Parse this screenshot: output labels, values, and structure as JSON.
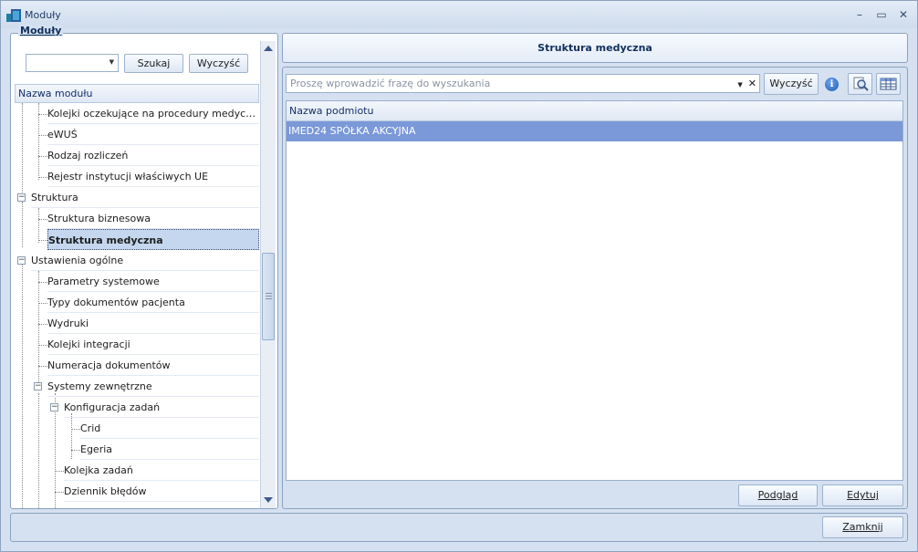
{
  "window": {
    "title": "Moduły"
  },
  "left": {
    "group_caption": "Moduły",
    "combo_value": "",
    "search_button": "Szukaj",
    "clear_button": "Wyczyść",
    "tree_header": "Nazwa modułu",
    "tree": [
      {
        "label": "Kolejki oczekujące na procedury medyczne lu...",
        "level": 1
      },
      {
        "label": "eWUŚ",
        "level": 1
      },
      {
        "label": "Rodzaj rozliczeń",
        "level": 1
      },
      {
        "label": "Rejestr instytucji właściwych UE",
        "level": 1
      },
      {
        "label": "Struktura",
        "level": 0
      },
      {
        "label": "Struktura biznesowa",
        "level": 1
      },
      {
        "label": "Struktura medyczna",
        "level": 1,
        "selected": true
      },
      {
        "label": "Ustawienia ogólne",
        "level": 0
      },
      {
        "label": "Parametry systemowe",
        "level": 1
      },
      {
        "label": "Typy dokumentów pacjenta",
        "level": 1
      },
      {
        "label": "Wydruki",
        "level": 1
      },
      {
        "label": "Kolejki integracji",
        "level": 1
      },
      {
        "label": "Numeracja dokumentów",
        "level": 1
      },
      {
        "label": "Systemy zewnętrzne",
        "level": 1
      },
      {
        "label": "Konfiguracja zadań",
        "level": 2
      },
      {
        "label": "Crid",
        "level": 3
      },
      {
        "label": "Egeria",
        "level": 3
      },
      {
        "label": "Kolejka zadań",
        "level": 2
      },
      {
        "label": "Dziennik błędów",
        "level": 2
      }
    ]
  },
  "right": {
    "header_title": "Struktura medyczna",
    "search_placeholder": "Proszę wprowadzić frazę do wyszukania",
    "clear_button": "Wyczyść",
    "grid_header": "Nazwa podmiotu",
    "rows": [
      "IMED24 SPÓŁKA AKCYJNA"
    ],
    "preview_button": "Podgląd",
    "edit_button": "Edytuj"
  },
  "footer": {
    "close_button": "Zamknij"
  },
  "colors": {
    "selected_row": "#7b99d8",
    "tree_selected": "#c5d7ee",
    "accent_text": "#10305c"
  }
}
